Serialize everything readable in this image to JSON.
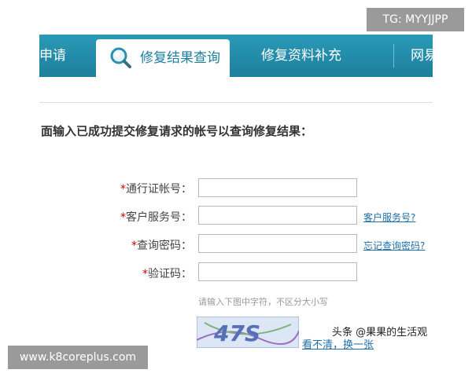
{
  "tabs": {
    "left_partial": "申请",
    "active": "修复结果查询",
    "third": "修复资料补充",
    "right_partial": "网易"
  },
  "instruction": "面输入已成功提交修复请求的帐号以查询修复结果：",
  "form": {
    "rows": [
      {
        "label": "通行证帐号：",
        "value": ""
      },
      {
        "label": "客户服务号：",
        "value": "",
        "link": "客户服务号?"
      },
      {
        "label": "查询密码：",
        "value": "",
        "link": "忘记查询密码?"
      },
      {
        "label": "验证码：",
        "value": ""
      }
    ],
    "required_mark": "*",
    "hint": "请输入下图中字符，不区分大小写",
    "captcha_text": "47S",
    "refresh_link": "看不清，换一张"
  },
  "overlays": {
    "tg_badge": "TG: MYYJJPP",
    "site_badge": "www.k8coreplus.com",
    "watermark": "头条 @果果的生活观"
  },
  "colors": {
    "tab_bar": "#1d7f9c",
    "link": "#1d6fa8",
    "required": "#cc0000"
  }
}
